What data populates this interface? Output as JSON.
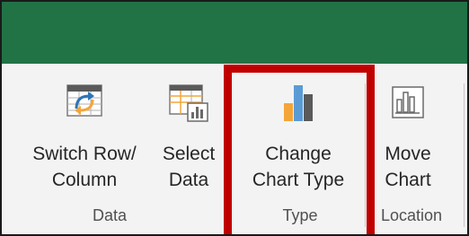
{
  "ribbon": {
    "buttons": {
      "switch_row_column": {
        "line1": "Switch Row/",
        "line2": "Column",
        "icon": "switch-row-column-icon"
      },
      "select_data": {
        "line1": "Select",
        "line2": "Data",
        "icon": "select-data-icon"
      },
      "change_chart_type": {
        "line1": "Change",
        "line2": "Chart Type",
        "icon": "bar-chart-icon"
      },
      "move_chart": {
        "line1": "Move",
        "line2": "Chart",
        "icon": "move-chart-icon"
      }
    },
    "groups": {
      "data": "Data",
      "type": "Type",
      "location": "Location"
    }
  },
  "colors": {
    "titlebar": "#217346",
    "highlight": "#c00000",
    "ribbon_bg": "#f3f3f3",
    "chart_orange": "#f4a53a",
    "chart_blue": "#5b9bd5",
    "chart_gray": "#5a5a5a"
  }
}
